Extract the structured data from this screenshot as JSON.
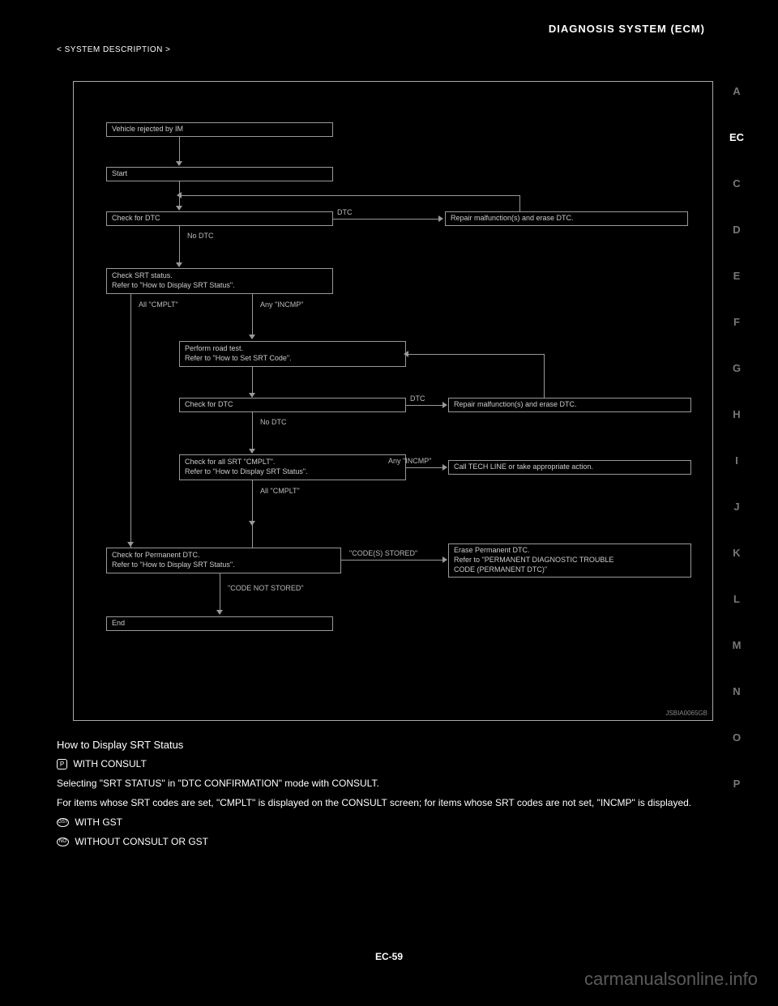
{
  "header": {
    "page_label": "DIAGNOSIS SYSTEM (ECM)"
  },
  "section": {
    "subtitle": "< SYSTEM DESCRIPTION >"
  },
  "sidebar": {
    "items": [
      {
        "label": "A",
        "active": false
      },
      {
        "label": "EC",
        "active": true
      },
      {
        "label": "C",
        "active": false
      },
      {
        "label": "D",
        "active": false
      },
      {
        "label": "E",
        "active": false
      },
      {
        "label": "F",
        "active": false
      },
      {
        "label": "G",
        "active": false
      },
      {
        "label": "H",
        "active": false
      },
      {
        "label": "I",
        "active": false
      },
      {
        "label": "J",
        "active": false
      },
      {
        "label": "K",
        "active": false
      },
      {
        "label": "L",
        "active": false
      },
      {
        "label": "M",
        "active": false
      },
      {
        "label": "N",
        "active": false
      },
      {
        "label": "O",
        "active": false
      },
      {
        "label": "P",
        "active": false
      }
    ]
  },
  "chart_data": {
    "type": "flowchart",
    "nodes": {
      "n1": "Vehicle rejected by IM",
      "n2": "Start",
      "n3": "Check for DTC",
      "n4_l1": "Check SRT status.",
      "n4_l2": "Refer to \"How to Display SRT Status\".",
      "n5_l1": "Perform road test.",
      "n5_l2": "Refer to \"How to Set SRT Code\".",
      "n6": "Check for DTC",
      "n7_l1": "Check for all SRT \"CMPLT\".",
      "n7_l2": "Refer to \"How to Display SRT Status\".",
      "n8_l1": "Check for Permanent DTC.",
      "n8_l2": "Refer to \"How to Display SRT Status\".",
      "n9": "End",
      "r1": "Repair malfunction(s) and erase DTC.",
      "r2": "Repair malfunction(s) and erase DTC.",
      "r3": "Call TECH LINE or take appropriate action.",
      "r4_l1": "Erase Permanent DTC.",
      "r4_l2": "Refer to \"PERMANENT DIAGNOSTIC TROUBLE",
      "r4_l3": "CODE (PERMANENT DTC)\""
    },
    "edge_labels": {
      "e3_r1": "DTC",
      "e3_4": "No DTC",
      "e4_left": "All \"CMPLT\"",
      "e4_right": "Any \"INCMP\"",
      "e6_r2": "DTC",
      "e6_7": "No DTC",
      "e7_r3": "Any \"INCMP\"",
      "e7_8": "All \"CMPLT\"",
      "e8_r4": "\"CODE(S) STORED\"",
      "e8_9": "\"CODE NOT STORED\""
    },
    "diagram_id": "JSBIA0065GB"
  },
  "body": {
    "heading1": "How to Display SRT Status",
    "p1": " WITH CONSULT",
    "p2": "Selecting \"SRT STATUS\" in \"DTC CONFIRMATION\" mode with CONSULT.",
    "p3": "For items whose SRT codes are set, \"CMPLT\" is displayed on the CONSULT screen; for items whose SRT codes are not set, \"INCMP\" is displayed.",
    "p4_prefix": " WITH GST",
    "p5_prefix": " WITHOUT CONSULT OR GST"
  },
  "footer": {
    "page_number": "EC-59"
  },
  "watermark": "carmanualsonline.info"
}
